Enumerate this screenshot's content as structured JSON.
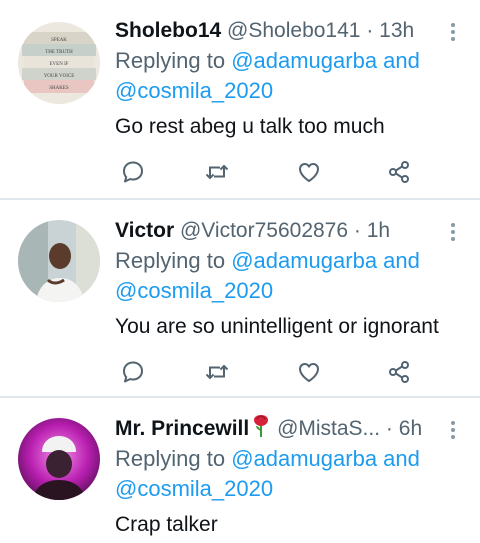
{
  "tweets": [
    {
      "name": "Sholebo14",
      "handle": "@Sholebo141",
      "separator": "·",
      "time": "13h",
      "replying_prefix": "Replying to ",
      "mention1": "@adamugarba",
      "mention_join": " and",
      "mention2": "@cosmila_2020",
      "text": "Go rest abeg u talk too much",
      "avatar_books": [
        "SPEAK",
        "THE TRUTH",
        "EVEN IF",
        "YOUR VOICE",
        "SHAKES"
      ]
    },
    {
      "name": "Victor",
      "handle": "@Victor75602876",
      "separator": "·",
      "time": "1h",
      "replying_prefix": "Replying to ",
      "mention1": "@adamugarba",
      "mention_join": " and",
      "mention2": "@cosmila_2020",
      "text": "You are so unintelligent or ignorant"
    },
    {
      "name": "Mr. Princewill",
      "handle": "@MistaS...",
      "separator": "·",
      "time": "6h",
      "replying_prefix": "Replying to ",
      "mention1": "@adamugarba",
      "mention_join": " and",
      "mention2": "@cosmila_2020",
      "text": "Crap talker"
    }
  ],
  "icons": [
    "reply-icon",
    "retweet-icon",
    "like-icon",
    "share-icon",
    "more-icon",
    "rose-icon"
  ],
  "colors": {
    "link": "#1d9bf0",
    "secondary_text": "#536471",
    "icon": "#536471",
    "divider": "#e1e8ed"
  }
}
